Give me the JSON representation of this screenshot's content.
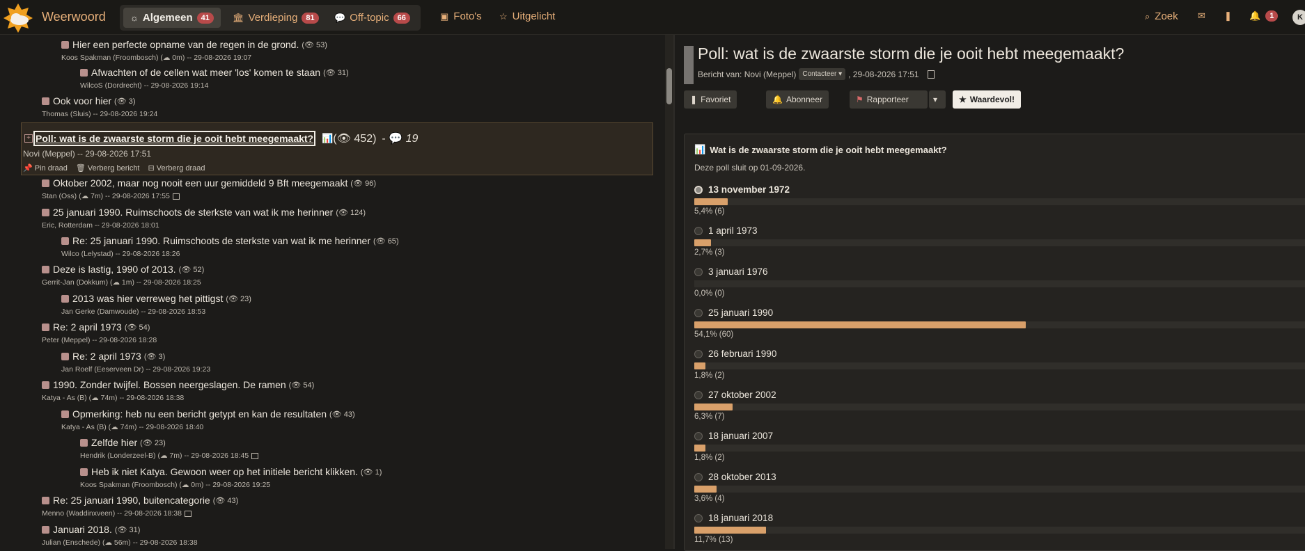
{
  "brand": "Weerwoord",
  "tabs": [
    {
      "label": "Algemeen",
      "count": "41"
    },
    {
      "label": "Verdieping",
      "count": "81"
    },
    {
      "label": "Off-topic",
      "count": "66"
    }
  ],
  "nav": {
    "photos": "Foto's",
    "featured": "Uitgelicht",
    "search": "Zoek",
    "notif_count": "1",
    "avatar": "K"
  },
  "posts": [
    {
      "title": "Hier een perfecte opname van de regen in de grond.",
      "views": "53",
      "meta": "Koos Spakman (Froombosch) (☁ 0m) -- 29-08-2026 19:07"
    },
    {
      "title": "Afwachten of de cellen wat meer 'los' komen te staan",
      "views": "31",
      "meta": "WilcoS (Dordrecht) -- 29-08-2026 19:14"
    },
    {
      "title": "Ook voor hier",
      "views": "3",
      "meta": "Thomas (Sluis) -- 29-08-2026 19:24"
    },
    {
      "title": "Oktober 2002, maar nog nooit een uur gemiddeld 9 Bft meegemaakt",
      "views": "96",
      "meta": "Stan (Oss) (☁ 7m) -- 29-08-2026 17:55"
    },
    {
      "title": "25 januari 1990. Ruimschoots de sterkste van wat ik me herinner",
      "views": "124",
      "meta": "Eric, Rotterdam -- 29-08-2026 18:01"
    },
    {
      "title": "Re: 25 januari 1990. Ruimschoots de sterkste van wat ik me herinner",
      "views": "65",
      "meta": "Wilco (Lelystad) -- 29-08-2026 18:26"
    },
    {
      "title": "Deze is lastig, 1990 of 2013.",
      "views": "52",
      "meta": "Gerrit-Jan (Dokkum) (☁ 1m) -- 29-08-2026 18:25"
    },
    {
      "title": "2013 was hier verreweg het pittigst",
      "views": "23",
      "meta": "Jan Gerke (Damwoude) -- 29-08-2026 18:53"
    },
    {
      "title": "Re: 2 april 1973",
      "views": "54",
      "meta": "Peter (Meppel) -- 29-08-2026 18:28"
    },
    {
      "title": "Re: 2 april 1973",
      "views": "3",
      "meta": "Jan Roelf (Eeserveen Dr) -- 29-08-2026 19:23"
    },
    {
      "title": "1990. Zonder twijfel. Bossen neergeslagen. De ramen",
      "views": "54",
      "meta": "Katya - As (B) (☁ 74m) -- 29-08-2026 18:38"
    },
    {
      "title": "Opmerking: heb nu een bericht getypt en kan de resultaten",
      "views": "43",
      "meta": "Katya - As (B) (☁ 74m) -- 29-08-2026 18:40"
    },
    {
      "title": "Zelfde hier",
      "views": "23",
      "meta": "Hendrik (Londerzeel-B) (☁ 7m) -- 29-08-2026 18:45"
    },
    {
      "title": "Heb ik niet Katya. Gewoon weer op het initiele bericht klikken.",
      "views": "1",
      "meta": "Koos Spakman (Froombosch) (☁ 0m) -- 29-08-2026 19:25"
    },
    {
      "title": "Re: 25 januari 1990, buitencategorie",
      "views": "43",
      "meta": "Menno (Waddinxveen) -- 29-08-2026 18:38"
    },
    {
      "title": "Januari 2018.",
      "views": "31",
      "meta": "Julian (Enschede) (☁ 56m) -- 29-08-2026 18:38"
    }
  ],
  "highlight": {
    "title": "Poll: wat is de zwaarste storm die je ooit hebt meegemaakt?",
    "views": "452",
    "replies": "19",
    "meta": "Novi (Meppel) -- 29-08-2026 17:51",
    "pin": "Pin draad",
    "hide_post": "Verberg bericht",
    "hide_thread": "Verberg draad"
  },
  "detail": {
    "title": "Poll: wat is de zwaarste storm die je ooit hebt meegemaakt?",
    "author_prefix": "Bericht van: Novi (Meppel)",
    "contact": "Contacteer",
    "date": ", 29-08-2026 17:51",
    "btn_fav": "Favoriet",
    "btn_sub": "Abonneer",
    "btn_report": "Rapporteer",
    "btn_valuable": "Waardevol!"
  },
  "poll": {
    "question": "Wat is de zwaarste storm die je ooit hebt meegemaakt?",
    "closes": "Deze poll sluit op 01-09-2026.",
    "options": [
      {
        "label": "13 november 1972",
        "pct_text": "5,4% (6)",
        "pct": 5.4,
        "selected": true
      },
      {
        "label": "1 april 1973",
        "pct_text": "2,7% (3)",
        "pct": 2.7
      },
      {
        "label": "3 januari 1976",
        "pct_text": "0,0% (0)",
        "pct": 0
      },
      {
        "label": "25 januari 1990",
        "pct_text": "54,1% (60)",
        "pct": 54.1
      },
      {
        "label": "26 februari 1990",
        "pct_text": "1,8% (2)",
        "pct": 1.8
      },
      {
        "label": "27 oktober 2002",
        "pct_text": "6,3% (7)",
        "pct": 6.3
      },
      {
        "label": "18 januari 2007",
        "pct_text": "1,8% (2)",
        "pct": 1.8
      },
      {
        "label": "28 oktober 2013",
        "pct_text": "3,6% (4)",
        "pct": 3.6
      },
      {
        "label": "18 januari 2018",
        "pct_text": "11,7% (13)",
        "pct": 11.7
      }
    ]
  },
  "colors": {
    "accent": "#e8b07a",
    "bar": "#d9a06a",
    "badge": "#b84a4a"
  }
}
